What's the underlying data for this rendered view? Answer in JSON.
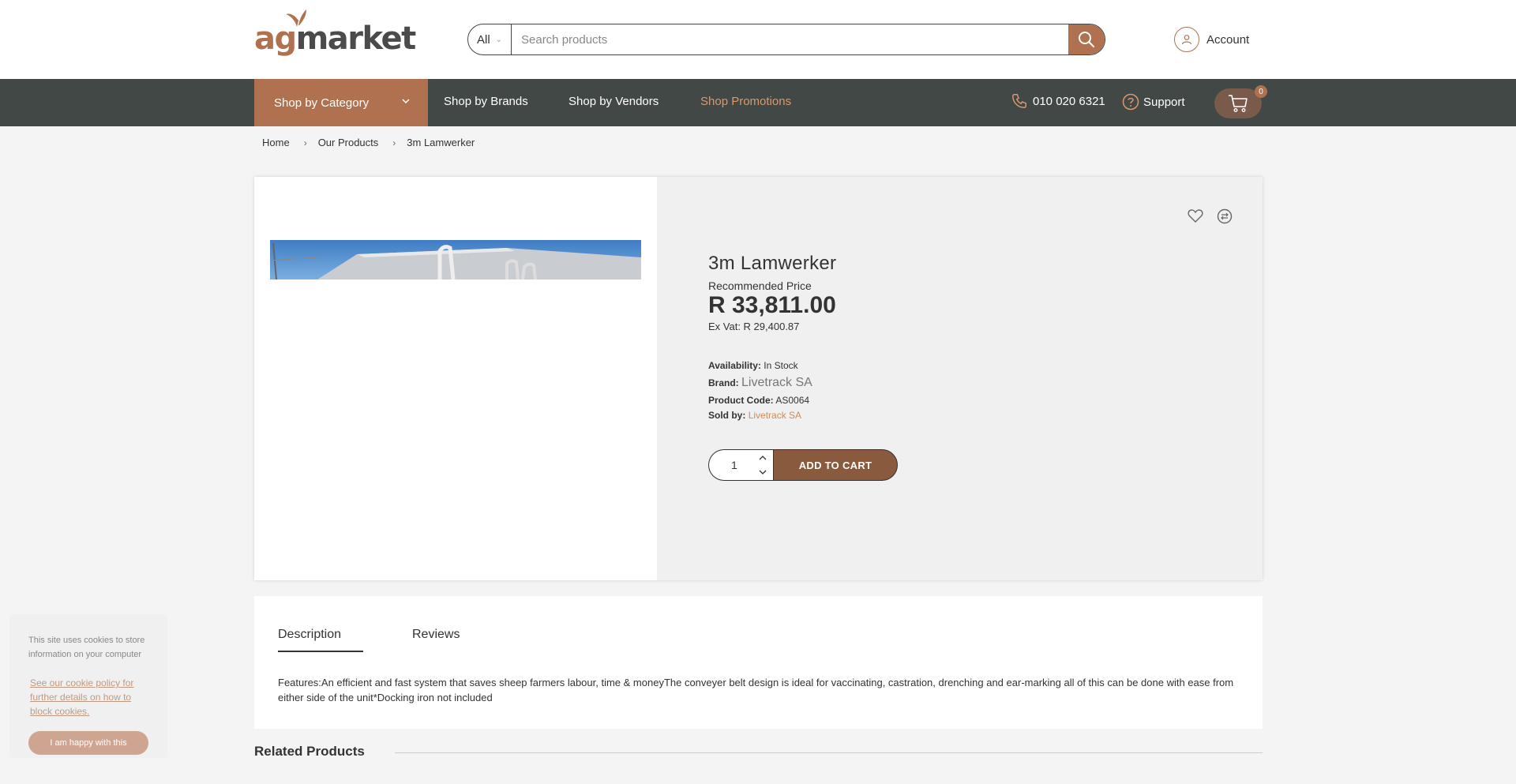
{
  "brand": {
    "logo_text_prefix": "ag",
    "logo_text_suffix": "market"
  },
  "search": {
    "category": "All",
    "placeholder": "Search products"
  },
  "account": {
    "label": "Account"
  },
  "nav": {
    "category": "Shop by Category",
    "brands": "Shop by Brands",
    "vendors": "Shop by Vendors",
    "promotions": "Shop Promotions",
    "phone": "010 020 6321",
    "support": "Support",
    "cart_count": "0"
  },
  "breadcrumb": [
    "Home",
    "Our Products",
    "3m Lamwerker"
  ],
  "product": {
    "title": "3m Lamwerker",
    "recommended_label": "Recommended Price",
    "price": "R 33,811.00",
    "ex_vat": "Ex Vat: R 29,400.87",
    "availability_label": "Availability:",
    "availability": "In Stock",
    "brand_label": "Brand:",
    "brand": "Livetrack SA",
    "code_label": "Product Code:",
    "code": "AS0064",
    "sold_by_label": "Sold by:",
    "sold_by": "Livetrack SA",
    "quantity": "1",
    "add_to_cart": "ADD TO CART"
  },
  "tabs": {
    "description": "Description",
    "reviews": "Reviews"
  },
  "description": "Features:An efficient and fast system that saves sheep farmers labour, time & moneyThe conveyer belt design is ideal for vaccinating, castration, drenching and ear-marking all of this can be done with ease from either side of the unit*Docking iron not included",
  "related": {
    "title": "Related Products"
  },
  "cookie": {
    "text": "This site uses cookies to store information on your computer",
    "link": "See our cookie policy for further details on how to block cookies.",
    "button": "I am happy with this"
  },
  "colors": {
    "accent": "#b07151",
    "nav_bg": "#414845",
    "promo": "#d69a70"
  }
}
